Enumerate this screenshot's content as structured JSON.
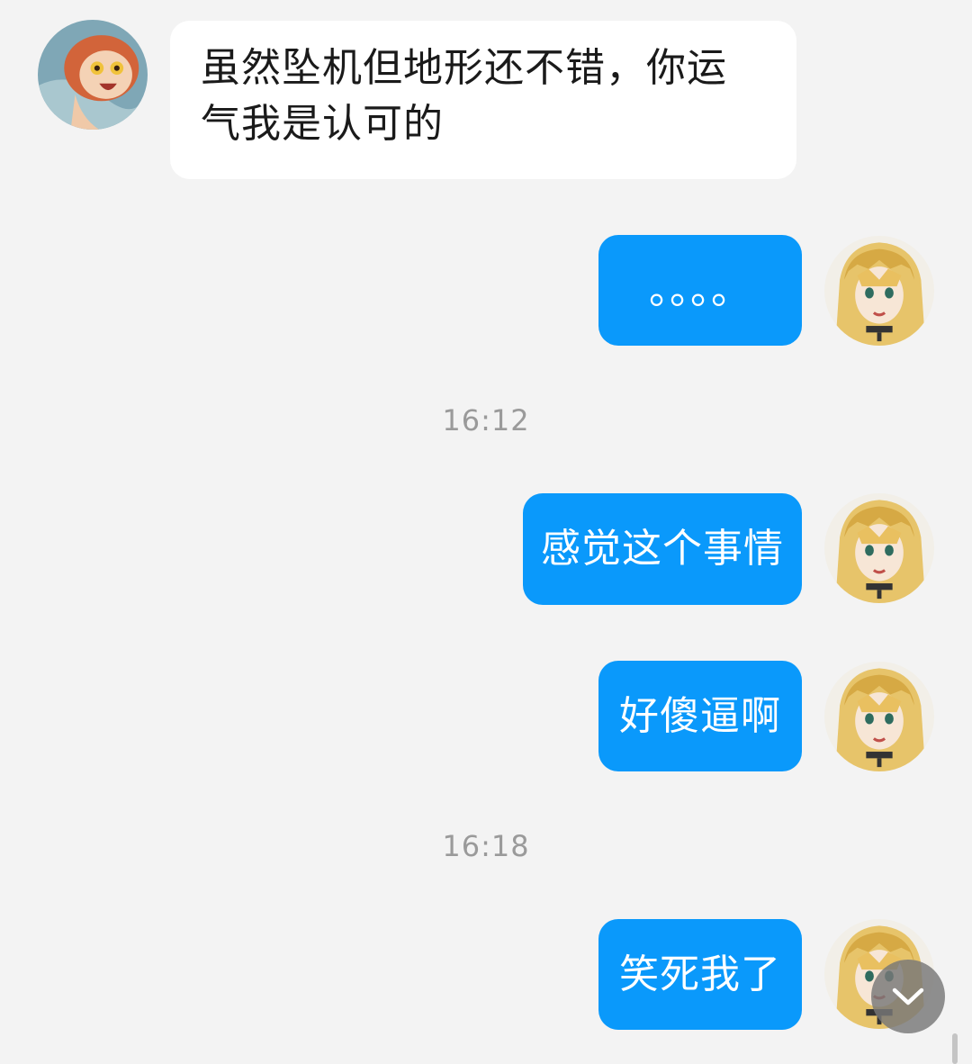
{
  "messages": [
    {
      "direction": "incoming",
      "sender": "contact",
      "text": "虽然坠机但地形还不错，你运气我是认可的"
    },
    {
      "direction": "outgoing",
      "sender": "me",
      "text": "。。。。"
    },
    {
      "type": "time",
      "text": "16:12"
    },
    {
      "direction": "outgoing",
      "sender": "me",
      "text": "感觉这个事情"
    },
    {
      "direction": "outgoing",
      "sender": "me",
      "text": "好傻逼啊"
    },
    {
      "type": "time",
      "text": "16:18"
    },
    {
      "direction": "outgoing",
      "sender": "me",
      "text": "笑死我了"
    }
  ],
  "colors": {
    "background": "#f3f3f3",
    "incoming_bubble": "#ffffff",
    "outgoing_bubble": "#0a99fb",
    "timestamp": "#9a9a9a"
  },
  "icons": {
    "scroll_down": "chevron-down-icon"
  }
}
